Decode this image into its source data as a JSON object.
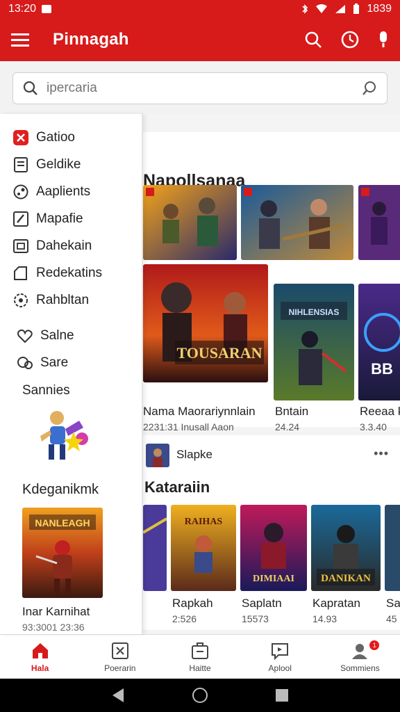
{
  "status_bar": {
    "time": "13:20",
    "battery": "1839"
  },
  "app_bar": {
    "title": "Pinnagah"
  },
  "search": {
    "placeholder": "ipercaria"
  },
  "drawer": {
    "items": [
      {
        "label": "Gatioo",
        "icon": "red-play-icon"
      },
      {
        "label": "Geldike",
        "icon": "library-icon"
      },
      {
        "label": "Aaplients",
        "icon": "apps-icon"
      },
      {
        "label": "Mapafie",
        "icon": "edit-icon"
      },
      {
        "label": "Dahekain",
        "icon": "screen-icon"
      },
      {
        "label": "Redekatins",
        "icon": "bookmark-icon"
      },
      {
        "label": "Rahbltan",
        "icon": "gear-icon"
      },
      {
        "label": "Salne",
        "icon": "heart-icon"
      },
      {
        "label": "Sare",
        "icon": "chat-icon"
      }
    ],
    "section_title": "Sannies",
    "featured_title": "Kdeganikmk",
    "featured_caption": "Inar Karnihat",
    "featured_sub": "93:3001 23:36"
  },
  "main": {
    "section1_title": "Napollsanaa",
    "items_row1": [
      {
        "caption": "Nama Maorariynnlain",
        "sub": "2231:31 Inusall Aaon"
      },
      {
        "caption": "Bntain",
        "sub": "24.24"
      },
      {
        "caption": "Reeaa k",
        "sub": "3.3.40"
      }
    ],
    "poster_text": {
      "p1": "TOUSARAN",
      "p2": "NIHLENSIAS",
      "p3": "BB"
    },
    "publisher": "Slapke",
    "more": "•••",
    "section2_title": "Kataraiin",
    "items_row2": [
      {
        "caption": "",
        "sub": ""
      },
      {
        "caption": "Rapkah",
        "sub": "2:526",
        "poster": "RAIHAS"
      },
      {
        "caption": "Saplatn",
        "sub": "15573",
        "poster": "DIMIAAI"
      },
      {
        "caption": "Kapratan",
        "sub": "14.93",
        "poster": "DANIKAN"
      },
      {
        "caption": "Sa",
        "sub": "45"
      }
    ]
  },
  "bottom_nav": [
    {
      "label": "Hala",
      "active": true
    },
    {
      "label": "Poerarin"
    },
    {
      "label": "Haitte"
    },
    {
      "label": "Aplool"
    },
    {
      "label": "Sommiens",
      "badge": "1"
    }
  ],
  "colors": {
    "brand": "#d71a1a"
  }
}
